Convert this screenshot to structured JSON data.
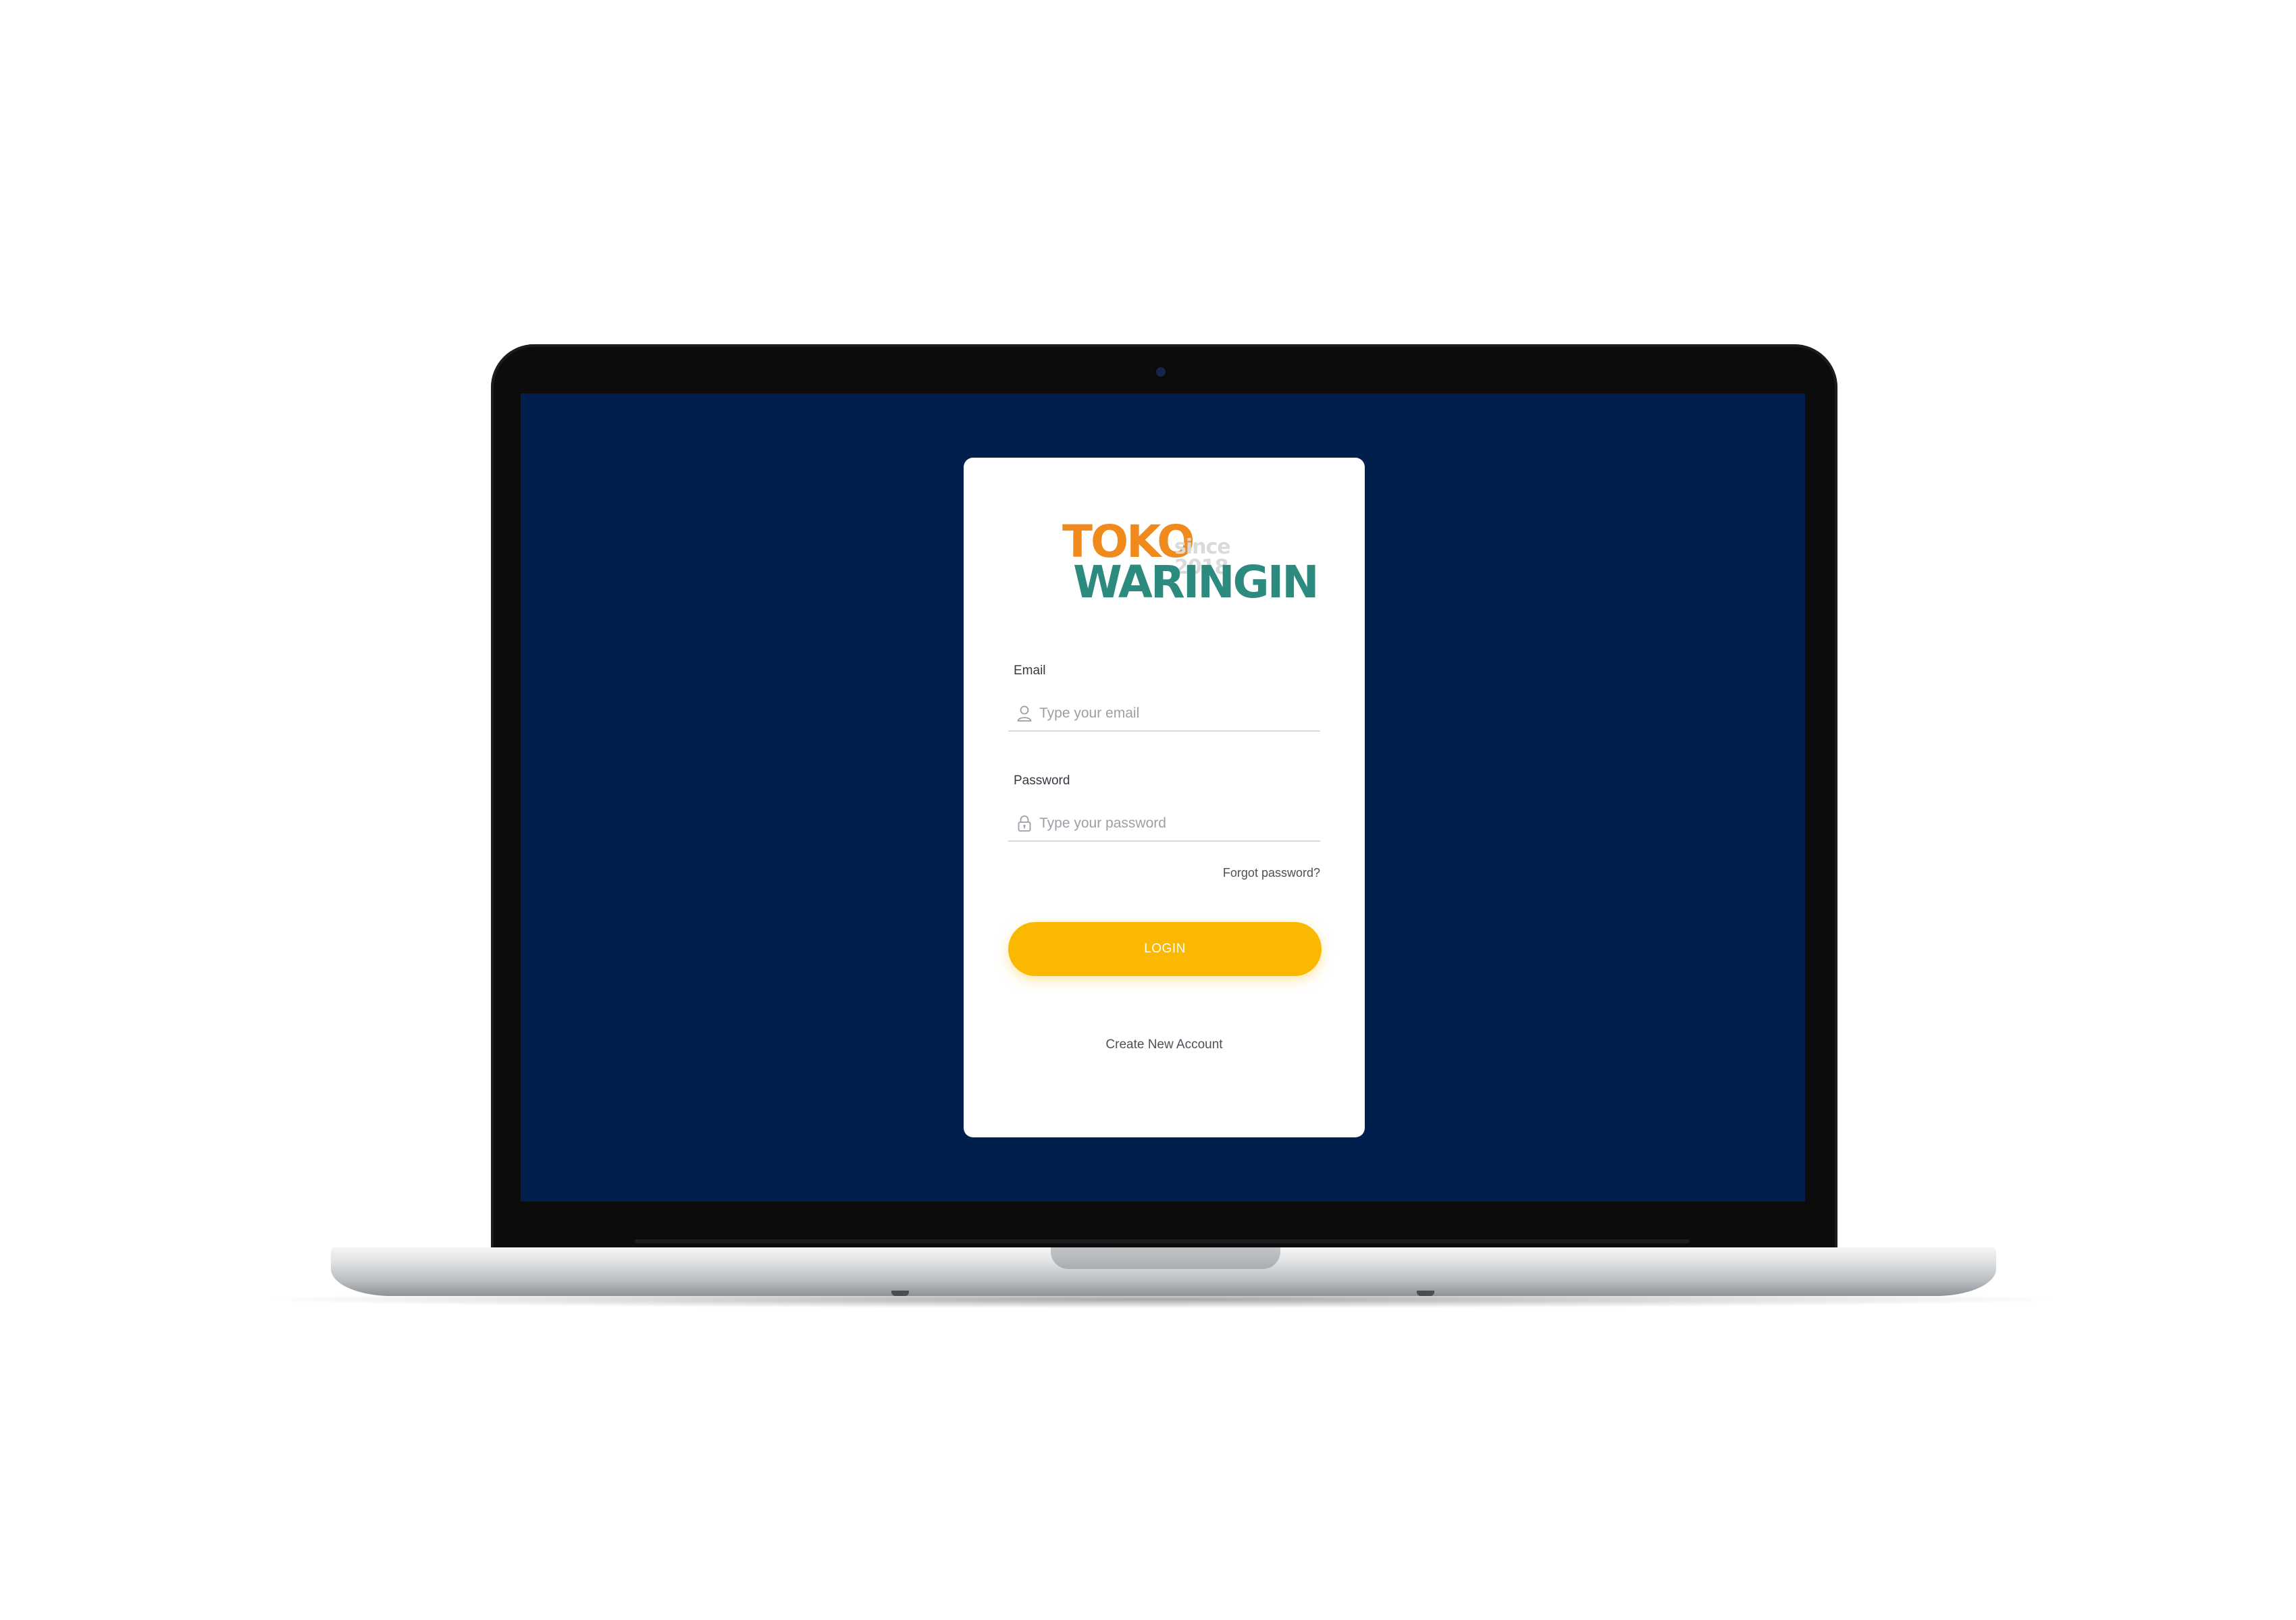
{
  "brand": {
    "line1": "TOKO",
    "tagline": "since 2018",
    "line2": "WARINGIN"
  },
  "login_form": {
    "email": {
      "label": "Email",
      "placeholder": "Type your email",
      "value": "",
      "icon": "user-icon"
    },
    "password": {
      "label": "Password",
      "placeholder": "Type your password",
      "value": "",
      "icon": "lock-icon"
    },
    "forgot_password_label": "Forgot password?",
    "login_button_label": "LOGIN",
    "create_account_label": "Create New Account"
  },
  "colors": {
    "screen_background": "#001f4c",
    "card_background": "#ffffff",
    "login_button": "#fbb800",
    "brand_orange": "#f08a1c",
    "brand_teal": "#2c8a7f",
    "laptop_bezel": "#0c0c0c"
  }
}
